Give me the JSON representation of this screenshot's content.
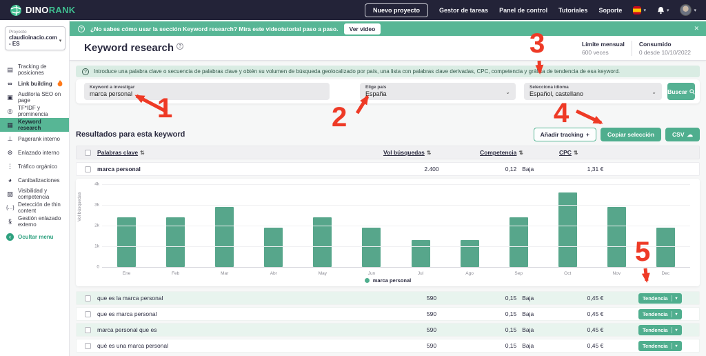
{
  "colors": {
    "accent_green": "#4fae8e",
    "banner_green": "#57b695",
    "topbar_navy": "#232338",
    "annotation_red": "#ee3a26",
    "bar_green": "#57a68b"
  },
  "glyphs": {
    "sort": "⇅",
    "chevron": "⌄",
    "caret": "▾",
    "cloud": "☁",
    "plus": "+",
    "question": "?",
    "close": "✕",
    "arrow_left": "‹",
    "trend_chevron": "▾"
  },
  "topbar": {
    "logo_dino": "DINO",
    "logo_rank": "RANK",
    "new_project": "Nuevo proyecto",
    "links": [
      "Gestor de tareas",
      "Panel de control",
      "Tutoriales",
      "Soporte"
    ]
  },
  "banner": {
    "text": "¿No sabes cómo usar la sección Keyword research? Mira este videotutorial paso a paso.",
    "button": "Ver video"
  },
  "sidebar": {
    "project_label": "Proyecto",
    "project_value": "claudioinacio.com - ES",
    "items": [
      {
        "icon": "▤",
        "label": "Tracking de posiciones"
      },
      {
        "icon": "∞",
        "label": "Link building"
      },
      {
        "icon": "▣",
        "label": "Auditoría SEO on page"
      },
      {
        "icon": "◎",
        "label": "TF*IDF y prominencia"
      },
      {
        "icon": "▦",
        "label": "Keyword research"
      },
      {
        "icon": "⊥",
        "label": "Pagerank interno"
      },
      {
        "icon": "⊛",
        "label": "Enlazado interno"
      },
      {
        "icon": "⋮",
        "label": "Tráfico orgánico"
      },
      {
        "icon": "◕",
        "label": "Canibalizaciones"
      },
      {
        "icon": "▨",
        "label": "Visibilidad y competencia"
      },
      {
        "icon": "{…}",
        "label": "Detección de thin content"
      },
      {
        "icon": "§",
        "label": "Gestión enlazado externo"
      }
    ],
    "hide_menu": "Ocultar menu"
  },
  "header": {
    "title": "Keyword research",
    "limit_label": "Límite mensual",
    "limit_value": "600 veces",
    "consumed_label": "Consumido",
    "consumed_value": "0 desde 10/10/2022"
  },
  "info_bar": "Introduce una palabra clave o secuencia de palabras clave y obtén su volumen de búsqueda geolocalizado por país, una lista con palabras clave derivadas, CPC, competencia y gráfica de tendencia de esa keyword.",
  "form": {
    "keyword_label": "Keyword a investigar",
    "keyword_value": "marca personal",
    "country_label": "Elige país",
    "country_value": "España",
    "language_label": "Selecciona idioma",
    "language_value": "Español, castellano",
    "search_button": "Buscar"
  },
  "results": {
    "title": "Resultados para esta keyword",
    "add_tracking": "Añadir tracking",
    "copy_selection": "Copiar selección",
    "csv": "CSV",
    "columns": {
      "keyword": "Palabras clave",
      "volume": "Vol búsquedas",
      "competition": "Competencia",
      "cpc": "CPC"
    },
    "main_row": {
      "keyword": "marca personal",
      "volume": "2.400",
      "competition": "0,12",
      "level": "Baja",
      "cpc": "1,31 €"
    },
    "trend_button": "Tendencia",
    "derived_rows": [
      {
        "keyword": "que es la marca personal",
        "volume": "590",
        "competition": "0,15",
        "level": "Baja",
        "cpc": "0,45 €"
      },
      {
        "keyword": "que es marca personal",
        "volume": "590",
        "competition": "0,15",
        "level": "Baja",
        "cpc": "0,45 €"
      },
      {
        "keyword": "marca personal que es",
        "volume": "590",
        "competition": "0,15",
        "level": "Baja",
        "cpc": "0,45 €"
      },
      {
        "keyword": "qué es una marca personal",
        "volume": "590",
        "competition": "0,15",
        "level": "Baja",
        "cpc": "0,45 €"
      }
    ]
  },
  "chart_data": {
    "type": "bar",
    "title": "",
    "categories": [
      "Ene",
      "Feb",
      "Mar",
      "Abr",
      "May",
      "Jun",
      "Jul",
      "Ago",
      "Sep",
      "Oct",
      "Nov",
      "Dec"
    ],
    "values": [
      2400,
      2400,
      2900,
      1900,
      2400,
      1900,
      1300,
      1300,
      2400,
      3600,
      2900,
      1900
    ],
    "ylabel": "Vol búsquedas",
    "yticks": [
      "4k",
      "3k",
      "2k",
      "1k",
      "0"
    ],
    "ylim": [
      0,
      4000
    ],
    "grid": true,
    "legend": [
      "marca personal"
    ],
    "legend_position": "bottom",
    "bar_color": "#57a68b"
  },
  "annotations": [
    "1",
    "2",
    "3",
    "4",
    "5"
  ]
}
